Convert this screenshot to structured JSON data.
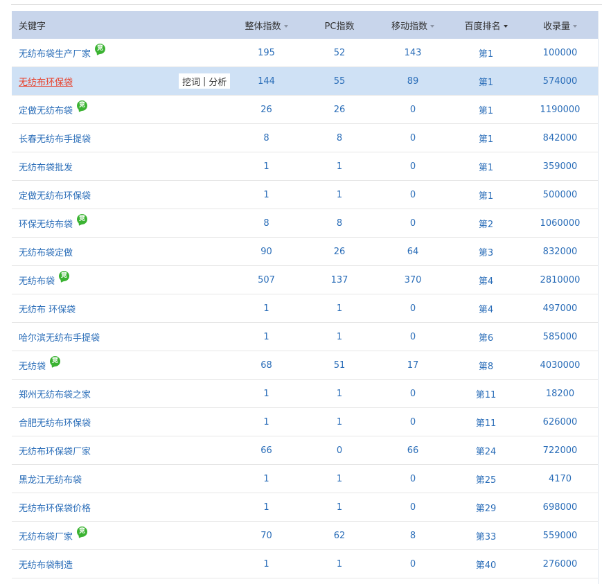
{
  "columns": {
    "keyword": "关键字",
    "overall_index": "整体指数",
    "pc_index": "PC指数",
    "mobile_index": "移动指数",
    "baidu_rank": "百度排名",
    "indexed": "收录量"
  },
  "badge_text": "竞",
  "badge_color": "#3bb332",
  "row_actions": {
    "dig": "挖词",
    "separator": "|",
    "analyze": "分析"
  },
  "rows": [
    {
      "keyword": "无纺布袋生产厂家",
      "overall": "195",
      "pc": "52",
      "mobile": "143",
      "rank": "第1",
      "indexed": "100000",
      "badge": true
    },
    {
      "keyword": "无纺布环保袋",
      "overall": "144",
      "pc": "55",
      "mobile": "89",
      "rank": "第1",
      "indexed": "574000",
      "badge": false,
      "selected": true
    },
    {
      "keyword": "定做无纺布袋",
      "overall": "26",
      "pc": "26",
      "mobile": "0",
      "rank": "第1",
      "indexed": "1190000",
      "badge": true
    },
    {
      "keyword": "长春无纺布手提袋",
      "overall": "8",
      "pc": "8",
      "mobile": "0",
      "rank": "第1",
      "indexed": "842000",
      "badge": false
    },
    {
      "keyword": "无纺布袋批发",
      "overall": "1",
      "pc": "1",
      "mobile": "0",
      "rank": "第1",
      "indexed": "359000",
      "badge": false
    },
    {
      "keyword": "定做无纺布环保袋",
      "overall": "1",
      "pc": "1",
      "mobile": "0",
      "rank": "第1",
      "indexed": "500000",
      "badge": false
    },
    {
      "keyword": "环保无纺布袋",
      "overall": "8",
      "pc": "8",
      "mobile": "0",
      "rank": "第2",
      "indexed": "1060000",
      "badge": true
    },
    {
      "keyword": "无纺布袋定做",
      "overall": "90",
      "pc": "26",
      "mobile": "64",
      "rank": "第3",
      "indexed": "832000",
      "badge": false
    },
    {
      "keyword": "无纺布袋",
      "overall": "507",
      "pc": "137",
      "mobile": "370",
      "rank": "第4",
      "indexed": "2810000",
      "badge": true
    },
    {
      "keyword": "无纺布 环保袋",
      "overall": "1",
      "pc": "1",
      "mobile": "0",
      "rank": "第4",
      "indexed": "497000",
      "badge": false
    },
    {
      "keyword": "哈尔滨无纺布手提袋",
      "overall": "1",
      "pc": "1",
      "mobile": "0",
      "rank": "第6",
      "indexed": "585000",
      "badge": false
    },
    {
      "keyword": "无纺袋",
      "overall": "68",
      "pc": "51",
      "mobile": "17",
      "rank": "第8",
      "indexed": "4030000",
      "badge": true
    },
    {
      "keyword": "郑州无纺布袋之家",
      "overall": "1",
      "pc": "1",
      "mobile": "0",
      "rank": "第11",
      "indexed": "18200",
      "badge": false
    },
    {
      "keyword": "合肥无纺布环保袋",
      "overall": "1",
      "pc": "1",
      "mobile": "0",
      "rank": "第11",
      "indexed": "626000",
      "badge": false
    },
    {
      "keyword": "无纺布环保袋厂家",
      "overall": "66",
      "pc": "0",
      "mobile": "66",
      "rank": "第24",
      "indexed": "722000",
      "badge": false
    },
    {
      "keyword": "黑龙江无纺布袋",
      "overall": "1",
      "pc": "1",
      "mobile": "0",
      "rank": "第25",
      "indexed": "4170",
      "badge": false
    },
    {
      "keyword": "无纺布环保袋价格",
      "overall": "1",
      "pc": "1",
      "mobile": "0",
      "rank": "第29",
      "indexed": "698000",
      "badge": false
    },
    {
      "keyword": "无纺布袋厂家",
      "overall": "70",
      "pc": "62",
      "mobile": "8",
      "rank": "第33",
      "indexed": "559000",
      "badge": true
    },
    {
      "keyword": "无纺布袋制造",
      "overall": "1",
      "pc": "1",
      "mobile": "0",
      "rank": "第40",
      "indexed": "276000",
      "badge": false
    }
  ]
}
